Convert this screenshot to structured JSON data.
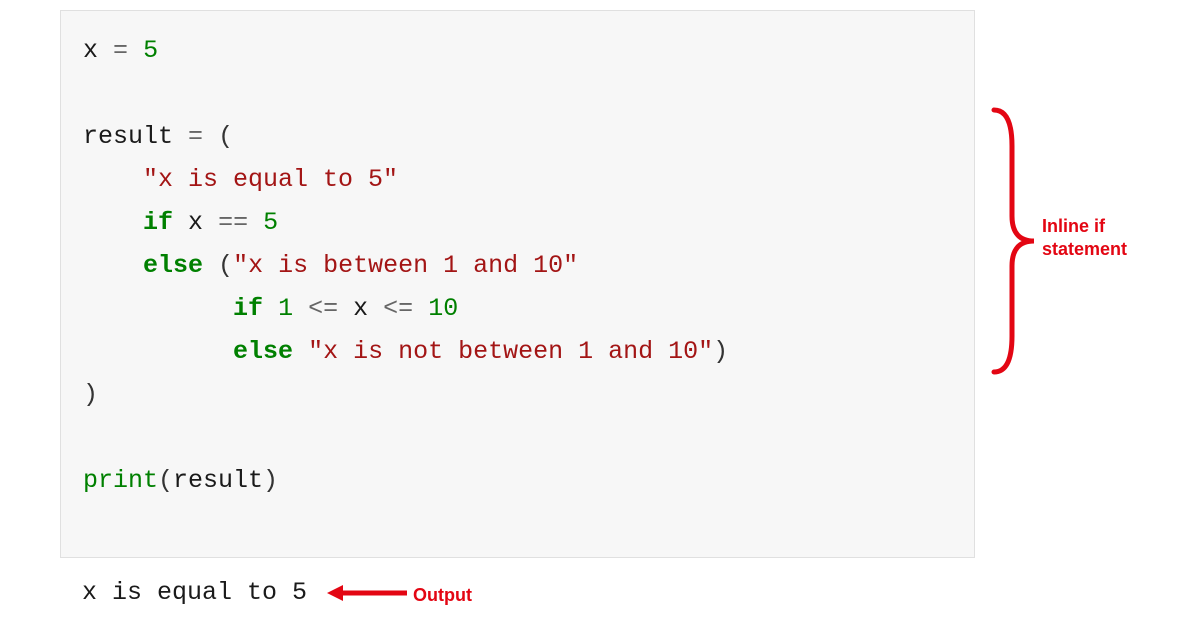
{
  "code": {
    "line1": {
      "var": "x",
      "sp1": " ",
      "op": "=",
      "sp2": " ",
      "num": "5"
    },
    "line2": "",
    "line3": {
      "var": "result",
      "sp1": " ",
      "op": "=",
      "sp2": " ",
      "paren": "("
    },
    "line4": {
      "indent": "    ",
      "str": "\"x is equal to 5\""
    },
    "line5": {
      "indent": "    ",
      "kw": "if",
      "sp1": " ",
      "var": "x",
      "sp2": " ",
      "op": "==",
      "sp3": " ",
      "num": "5"
    },
    "line6": {
      "indent": "    ",
      "kw": "else",
      "sp1": " ",
      "paren": "(",
      "str": "\"x is between 1 and 10\""
    },
    "line7": {
      "indent": "          ",
      "kw": "if",
      "sp1": " ",
      "num1": "1",
      "sp2": " ",
      "op1": "<=",
      "sp3": " ",
      "var": "x",
      "sp4": " ",
      "op2": "<=",
      "sp5": " ",
      "num2": "10"
    },
    "line8": {
      "indent": "          ",
      "kw": "else",
      "sp1": " ",
      "str": "\"x is not between 1 and 10\"",
      "paren": ")"
    },
    "line9": {
      "paren": ")"
    },
    "line10": "",
    "line11": {
      "fn": "print",
      "paren1": "(",
      "var": "result",
      "paren2": ")"
    }
  },
  "output": "x is equal to 5",
  "annotations": {
    "inline_if": "Inline if statement",
    "output_label": "Output"
  },
  "colors": {
    "annotation": "#e30613"
  }
}
